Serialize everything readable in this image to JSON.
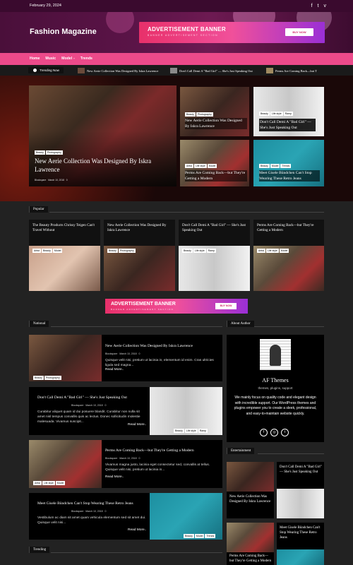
{
  "topbar": {
    "date": "February 29, 2024",
    "social": [
      "f",
      "t",
      "v"
    ]
  },
  "header": {
    "site_title": "Fashion Magazine"
  },
  "ad": {
    "title": "ADVERTISEMENT BANNER",
    "subtitle": "BANNER ADVERTISEMENT SECTION",
    "button": "BUY NOW"
  },
  "nav": {
    "items": [
      "Home",
      "Music",
      "Model",
      "Trends"
    ],
    "dropdown_marker": "-"
  },
  "ticker": {
    "label": "Trending Now",
    "items": [
      "New Aerie Collection Was Designed By Iskra Lawrence",
      "Don't Call Demi A \"Bad Girl\" — She's Just Speaking Out",
      "Perms Are Coming Back—but T"
    ]
  },
  "hero": {
    "main": {
      "tags": [
        "Beauty",
        "Photography"
      ],
      "title": "New Aerie Collection Was Designed By Iskra Lawrence",
      "author": "Blockspare",
      "date": "March 10, 2018",
      "comments": "0"
    },
    "small": [
      {
        "tags": [
          "Beauty",
          "Photography"
        ],
        "title": "New Aerie Collection Was Designed By Iskra Lawrence"
      },
      {
        "tags": [
          "Beauty",
          "Life style",
          "Ramp"
        ],
        "title": "Don't Call Demi A \"Bad Girl\" — She's Just Speaking Out"
      },
      {
        "tags": [
          "Artist",
          "Life style",
          "Model"
        ],
        "title": "Perms Are Coming Back—but They're Getting a Modern"
      },
      {
        "tags": [
          "Beauty",
          "Model",
          "Trends"
        ],
        "title": "Meet Gisele Bündchen Can't Stop Wearing These Retro Jeans"
      }
    ]
  },
  "popular": {
    "heading": "Popular",
    "items": [
      {
        "title": "The Beauty Products Chrissy Teigen Can't Travel Without",
        "tags": [
          "Artist",
          "Beauty",
          "Model"
        ]
      },
      {
        "title": "New Aerie Collection Was Designed By Iskra Lawrence",
        "tags": [
          "Beauty",
          "Photography"
        ]
      },
      {
        "title": "Don't Call Demi A \"Bad Girl\" — She's Just Speaking Out",
        "tags": [
          "Beauty",
          "Life style",
          "Ramp"
        ]
      },
      {
        "title": "Perms Are Coming Back—but They're Getting a Modern",
        "tags": [
          "Artist",
          "Life style",
          "Model"
        ]
      }
    ]
  },
  "national": {
    "heading": "National",
    "items": [
      {
        "title": "New Aerie Collection Was Designed By Iskra Lawrence",
        "author": "Blockspare",
        "date": "March 10, 2018",
        "comments": "0",
        "excerpt": "Quisque velit nisi, pretium ut lacinia in, elementum id enim. Cras ultricies ligula sed magna...",
        "more": "Read More..",
        "tags": [
          "Beauty",
          "Photography"
        ]
      },
      {
        "title": "Don't Call Demi A \"Bad Girl\" — She's Just Speaking Out",
        "author": "Blockspare",
        "date": "March 10, 2018",
        "comments": "0",
        "excerpt": "Curabitur aliquet quam id dui posuere blandit. Curabitur non nulla sit amet nisl tempus convallis quis ac lectus. Donec sollicitudin molestie malesuada. Vivamus suscipit...",
        "more": "Read More..",
        "tags": [
          "Beauty",
          "Life style",
          "Ramp"
        ]
      },
      {
        "title": "Perms Are Coming Back—but They're Getting a Modern",
        "author": "Blockspare",
        "date": "March 10, 2018",
        "comments": "0",
        "excerpt": "Vivamus magna justo, lacinia eget consectetur sed, convallis at tellus. Quisque velit nisi, pretium ut lacinia in...",
        "more": "Read More..",
        "tags": [
          "Artist",
          "Life style",
          "Model"
        ]
      },
      {
        "title": "Meet Gisele Bündchen Can't Stop Wearing These Retro Jeans",
        "author": "Blockspare",
        "date": "March 10, 2018",
        "comments": "0",
        "excerpt": "Vestibulum ac diam sit amet quam vehicula elementum sed sit amet dui. Quisque velit nisi...",
        "more": "Read More..",
        "tags": [
          "Beauty",
          "Model",
          "Trends"
        ]
      }
    ]
  },
  "about": {
    "heading": "About Author",
    "name": "AF Themes",
    "tagline": "themes, plugins, support",
    "bio": "We mainly focus on quality code and elegant design with incredible support. Our WordPress themes and plugins empower you to create a sleek, professional, and easy-to-maintain website quickly."
  },
  "entertainment": {
    "heading": "Entertainment",
    "items": [
      {
        "title": "New Aerie Collection Was Designed By Iskra Lawrence"
      },
      {
        "title": "Don't Call Demi A \"Bad Girl\" — She's Just Speaking Out"
      },
      {
        "title": "Perms Are Coming Back—but They're Getting a Modern"
      },
      {
        "title": "Meet Gisele Bündchen Can't Stop Wearing These Retro Jeans"
      }
    ]
  },
  "trending": {
    "heading": "Trending"
  },
  "colors": {
    "accent": "#ec4a8a",
    "topbar": "#3a0a2e"
  }
}
